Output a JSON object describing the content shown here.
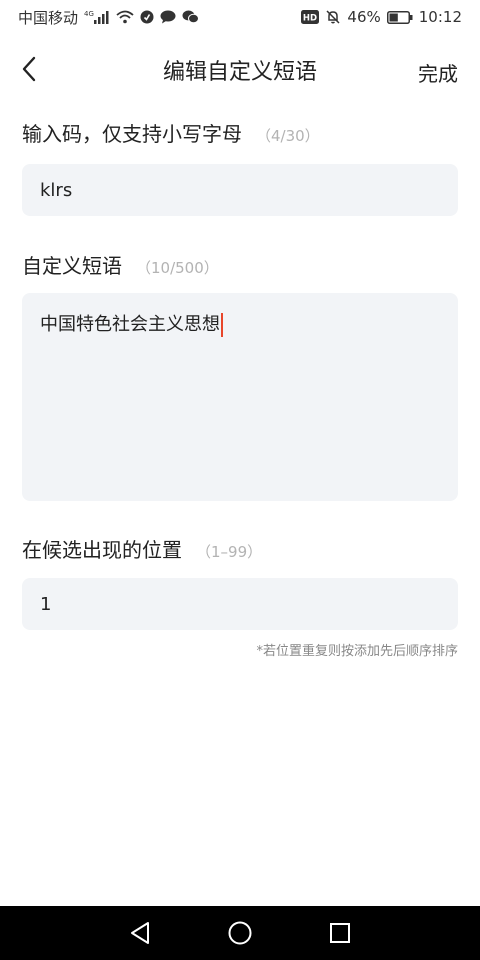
{
  "status_bar": {
    "carrier": "中国移动",
    "network": "4G",
    "hd_badge": "HD",
    "battery_percent": "46%",
    "battery_level": 0.46,
    "time": "10:12",
    "icons": [
      "signal-icon",
      "wifi-icon",
      "app-notification-icon",
      "message-icon",
      "wechat-icon",
      "mute-bell-icon",
      "battery-icon"
    ]
  },
  "header": {
    "title": "编辑自定义短语",
    "done_label": "完成"
  },
  "form": {
    "code": {
      "label": "输入码，仅支持小写字母",
      "counter": "（4/30）",
      "value": "klrs"
    },
    "phrase": {
      "label": "自定义短语",
      "counter": "（10/500）",
      "value": "中国特色社会主义思想"
    },
    "position": {
      "label": "在候选出现的位置",
      "counter": "（1–99）",
      "value": "1"
    },
    "hint": "*若位置重复则按添加先后顺序排序"
  },
  "nav_bar": {
    "icons": [
      "nav-back-icon",
      "nav-home-icon",
      "nav-recents-icon"
    ]
  }
}
